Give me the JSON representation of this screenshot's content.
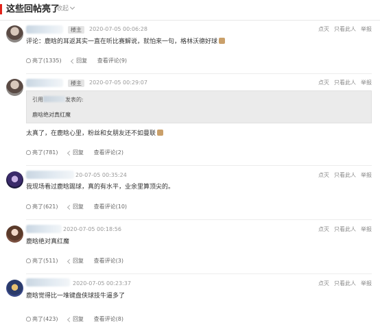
{
  "header": {
    "title": "这些回帖亮了",
    "collapse_label": "收起"
  },
  "actions_labels": {
    "dim": "点灭",
    "only_this": "只看此人",
    "report": "举报",
    "reply": "回复"
  },
  "comments": [
    {
      "host_badge": "楼主",
      "timestamp": "2020-07-05 00:06:28",
      "text": "评论：鹿晗的耳返其实一直在听比赛解说，就怕来一句，格林沃德好球",
      "like_label": "亮了(1335)",
      "view_label": "查看评论(9)"
    },
    {
      "host_badge": "楼主",
      "timestamp": "2020-07-05 00:29:07",
      "quote_prefix": "引用",
      "quote_suffix": "发表的:",
      "quote_text": "鹿晗绝对真红魔",
      "text": "太真了，在鹿晗心里，粉丝和女朋友还不如曼联",
      "like_label": "亮了(781)",
      "view_label": "查看评论(2)"
    },
    {
      "timestamp": "20-07-05 00:35:24",
      "text": "我现场看过鹿晗踢球，真的有水平，业余里算顶尖的。",
      "like_label": "亮了(621)",
      "view_label": "查看评论(10)"
    },
    {
      "timestamp": "2020-07-05 00:18:56",
      "text": "鹿晗绝对真红魔",
      "like_label": "亮了(511)",
      "view_label": "查看评论(3)"
    },
    {
      "timestamp": "2020-07-05 00:23:37",
      "text": "鹿晗觉得比一堆键盘侠球技牛逼多了",
      "like_label": "亮了(423)",
      "view_label": "查看评论(8)"
    }
  ]
}
